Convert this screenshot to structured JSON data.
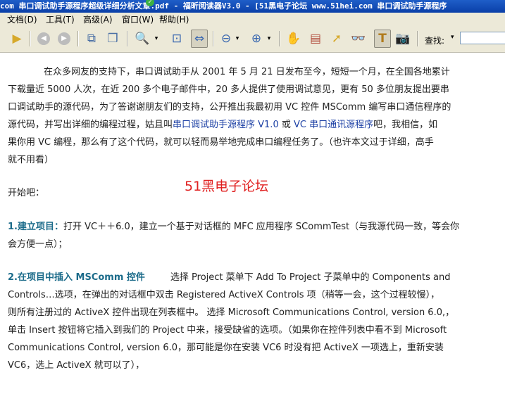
{
  "window": {
    "title": "com 串口调试助手源程序超级详细分析文章.pdf - 福昕阅读器V3.0 - [51黑电子论坛 www.51hei.com 串口调试助手源程序"
  },
  "menu": [
    "文档(D)",
    "工具(T)",
    "高级(A)",
    "窗口(W)",
    "帮助(H)"
  ],
  "toolbar": {
    "icons": [
      "play-icon",
      "back-icon",
      "forward-icon",
      "copy-icon",
      "page-icon",
      "zoom-icon",
      "fit-icon",
      "fit-width-icon",
      "zoom-out-icon",
      "zoom-in-icon",
      "hand-icon",
      "select-icon",
      "pointer-icon",
      "find-icon",
      "text-select-icon",
      "snapshot-icon"
    ],
    "search_label": "查找:",
    "search_value": ""
  },
  "doc": {
    "paragraph1": [
      "在众多网友的支持下，串口调试助手从 2001 年 5 月 21 日发布至今，短短一个月，在全国各地累计",
      "下载量近 5000 人次，在近 200 多个电子邮件中，20 多人提供了使用调试意见，更有 50 多位朋友提出要串",
      "口调试助手的源代码，为了答谢谢朋友们的支持，公开推出我最初用 VC 控件 MSComm 编写串口通信程序的",
      "源代码，并写出详细的编程过程，姑且叫",
      "串口调试助手源程序 V1.0",
      " 或 ",
      "VC 串口通讯源程序",
      "吧，我相信，如",
      "果你用 VC 编程，那么有了这个代码，就可以轻而易举地完成串口编程任务了。（也许本文过于详细，高手",
      "就不用看）"
    ],
    "brand": "51黑电子论坛",
    "start": "开始吧：",
    "step1_title": "1.建立项目：",
    "step1_text1": "打开 VC＋＋6.0，建立一个基于对话框的 MFC 应用程序 SCommTest（与我源代码一致，等会你",
    "step1_text2": "会方便一点）；",
    "step2_title": "2.在项目中插入 MSComm 控件",
    "step2_lines": [
      "选择 Project 菜单下 Add To Project 子菜单中的 Components and",
      "Controls…选项，在弹出的对话框中双击 Registered ActiveX Controls 项（稍等一会，这个过程较慢），",
      "则所有注册过的 ActiveX 控件出现在列表框中。 选择 Microsoft Communications Control, version 6.0,，",
      "单击 Insert 按钮将它插入到我们的 Project 中来，接受缺省的选项。（如果你在控件列表中看不到 Microsoft",
      "Communications Control, version 6.0，那可能是你在安装 VC6 时没有把 ActiveX 一项选上，重新安装",
      "VC6，选上 ActiveX 就可以了），"
    ]
  }
}
